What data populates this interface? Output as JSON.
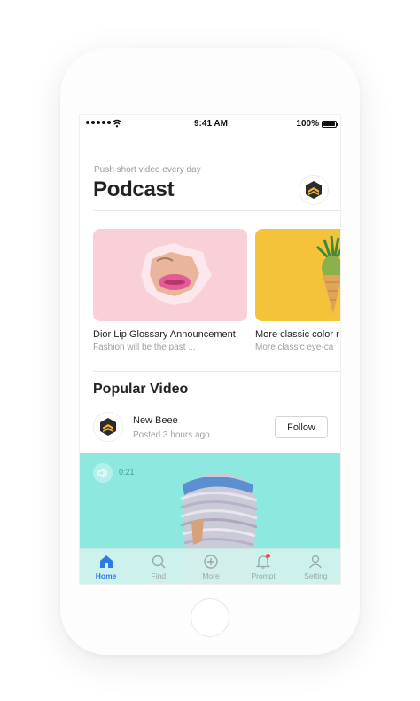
{
  "status": {
    "time": "9:41 AM",
    "battery": "100%"
  },
  "header": {
    "subtitle": "Push short video every day",
    "title": "Podcast"
  },
  "cards": [
    {
      "title": "Dior Lip Glossary Announcement",
      "subtitle": "Fashion will be the past ..."
    },
    {
      "title": "More classic color r",
      "subtitle": "More classic eye-ca"
    }
  ],
  "popular": {
    "title": "Popular Video",
    "user_name": "New Beee",
    "posted": "Posted 3 hours ago",
    "follow_label": "Follow",
    "duration": "0:21"
  },
  "tabs": [
    {
      "label": "Home",
      "icon": "home-icon",
      "active": true
    },
    {
      "label": "Find",
      "icon": "search-icon"
    },
    {
      "label": "More",
      "icon": "plus-circle-icon"
    },
    {
      "label": "Prompt",
      "icon": "bell-icon"
    },
    {
      "label": "Setting",
      "icon": "user-icon"
    }
  ],
  "colors": {
    "accent": "#2a7be4",
    "video_bg": "#8de9e0",
    "card_pink": "#f9d0d8",
    "card_yellow": "#f5c33a",
    "logo": "#f2b530"
  }
}
